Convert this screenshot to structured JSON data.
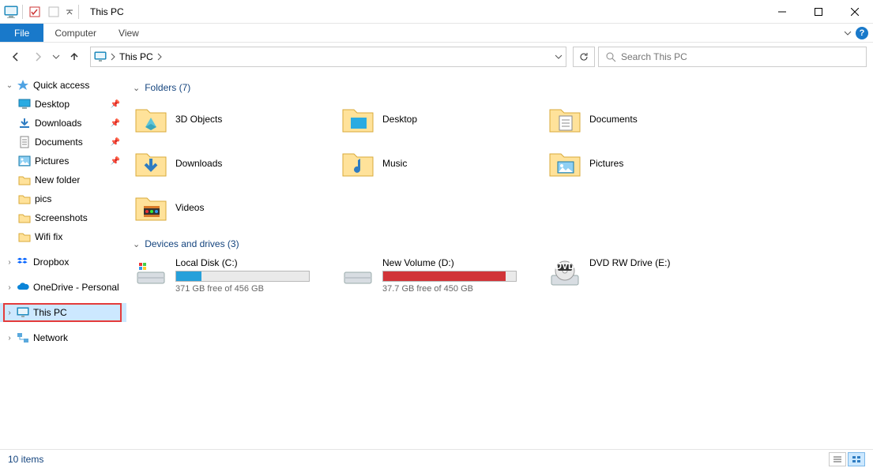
{
  "window": {
    "title": "This PC"
  },
  "ribbon": {
    "file": "File",
    "tabs": [
      "Computer",
      "View"
    ]
  },
  "address": {
    "location": "This PC"
  },
  "search": {
    "placeholder": "Search This PC"
  },
  "navpane": {
    "quick_access": {
      "label": "Quick access",
      "items": [
        {
          "label": "Desktop",
          "pinned": true
        },
        {
          "label": "Downloads",
          "pinned": true
        },
        {
          "label": "Documents",
          "pinned": true
        },
        {
          "label": "Pictures",
          "pinned": true
        },
        {
          "label": "New folder",
          "pinned": false
        },
        {
          "label": "pics",
          "pinned": false
        },
        {
          "label": "Screenshots",
          "pinned": false
        },
        {
          "label": "Wifi fix",
          "pinned": false
        }
      ]
    },
    "dropbox": {
      "label": "Dropbox"
    },
    "onedrive": {
      "label": "OneDrive - Personal"
    },
    "this_pc": {
      "label": "This PC"
    },
    "network": {
      "label": "Network"
    }
  },
  "groups": {
    "folders": {
      "header": "Folders (7)",
      "items": [
        "3D Objects",
        "Desktop",
        "Documents",
        "Downloads",
        "Music",
        "Pictures",
        "Videos"
      ]
    },
    "drives": {
      "header": "Devices and drives (3)",
      "items": [
        {
          "name": "Local Disk (C:)",
          "free": "371 GB free of 456 GB",
          "fill_pct": 19,
          "color": "blue"
        },
        {
          "name": "New Volume (D:)",
          "free": "37.7 GB free of 450 GB",
          "fill_pct": 92,
          "color": "red"
        },
        {
          "name": "DVD RW Drive (E:)",
          "free": "",
          "fill_pct": 0,
          "color": "none"
        }
      ]
    }
  },
  "status": {
    "text": "10 items"
  }
}
